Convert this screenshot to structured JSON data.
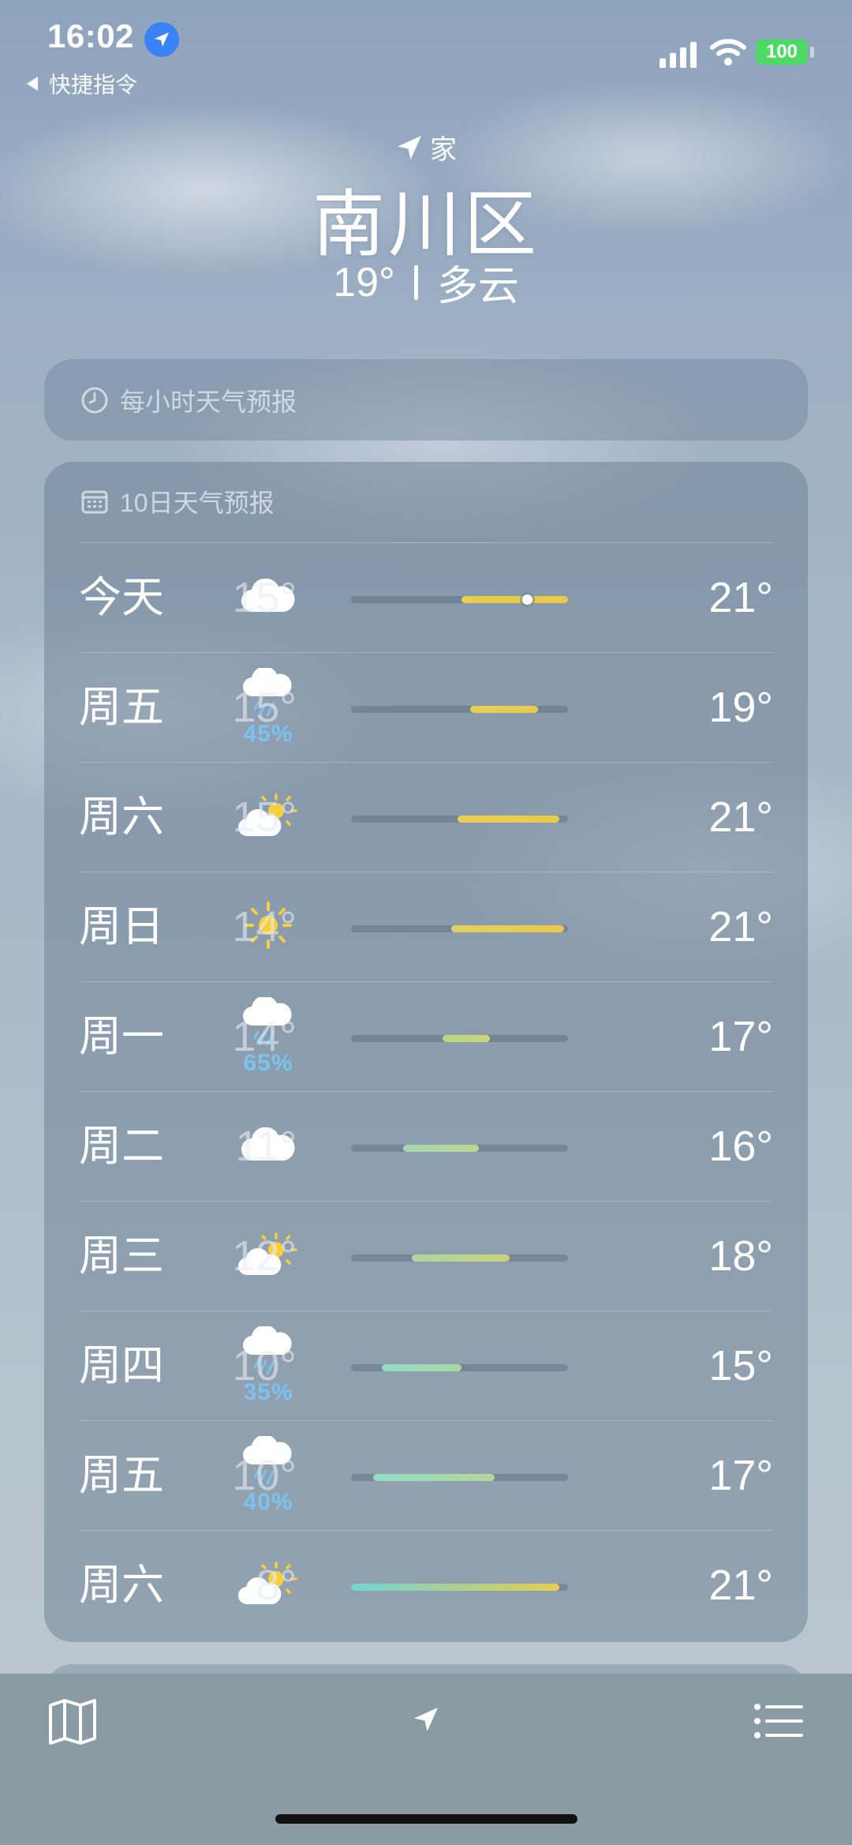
{
  "status_bar": {
    "time": "16:02",
    "back_label": "快捷指令",
    "battery": "100",
    "battery_color": "#4cd964",
    "location_color": "#3a82f7"
  },
  "header": {
    "location_label": "家",
    "city": "南川区",
    "temperature": "19°",
    "condition": "多云"
  },
  "hourly_card": {
    "title": "每小时天气预报",
    "icon": "clock-icon"
  },
  "daily_card": {
    "title": "10日天气预报",
    "icon": "calendar-icon",
    "days": [
      {
        "day": "今天",
        "icon": "cloud-icon",
        "precip": "",
        "low": "15°",
        "high": "21°",
        "bar_start": 0.51,
        "bar_end": 1.0,
        "now": 0.81,
        "gradient": [
          "#e9cd4c",
          "#ecc94a"
        ]
      },
      {
        "day": "周五",
        "icon": "cloud-rain-icon",
        "precip": "45%",
        "low": "15°",
        "high": "19°",
        "bar_start": 0.55,
        "bar_end": 0.86,
        "gradient": [
          "#e7ce52",
          "#e8cb4d"
        ]
      },
      {
        "day": "周六",
        "icon": "partly-sunny-icon",
        "precip": "",
        "low": "15°",
        "high": "21°",
        "bar_start": 0.49,
        "bar_end": 0.96,
        "gradient": [
          "#e8cf55",
          "#ebc94a"
        ]
      },
      {
        "day": "周日",
        "icon": "sun-icon",
        "precip": "",
        "low": "14°",
        "high": "21°",
        "bar_start": 0.46,
        "bar_end": 0.98,
        "gradient": [
          "#dfd065",
          "#ecc94a"
        ]
      },
      {
        "day": "周一",
        "icon": "cloud-rain-icon",
        "precip": "65%",
        "low": "14°",
        "high": "17°",
        "bar_start": 0.42,
        "bar_end": 0.64,
        "gradient": [
          "#b9d684",
          "#cdd377"
        ]
      },
      {
        "day": "周二",
        "icon": "cloud-icon",
        "precip": "",
        "low": "11°",
        "high": "16°",
        "bar_start": 0.24,
        "bar_end": 0.59,
        "gradient": [
          "#a4d8b0",
          "#bfd690"
        ]
      },
      {
        "day": "周三",
        "icon": "partly-sunny-icon",
        "precip": "",
        "low": "12°",
        "high": "18°",
        "bar_start": 0.28,
        "bar_end": 0.73,
        "gradient": [
          "#acd7a2",
          "#c9d27b"
        ]
      },
      {
        "day": "周四",
        "icon": "cloud-rain-icon",
        "precip": "35%",
        "low": "10°",
        "high": "15°",
        "bar_start": 0.14,
        "bar_end": 0.51,
        "gradient": [
          "#8fdcc6",
          "#a9d7a4"
        ]
      },
      {
        "day": "周五",
        "icon": "cloud-rain-icon",
        "precip": "40%",
        "low": "10°",
        "high": "17°",
        "bar_start": 0.1,
        "bar_end": 0.66,
        "gradient": [
          "#8fdcc6",
          "#b4d699"
        ]
      },
      {
        "day": "周六",
        "icon": "partly-sunny-icon",
        "precip": "",
        "low": "8°",
        "high": "21°",
        "bar_start": 0.0,
        "bar_end": 0.96,
        "gradient": [
          "#6fd6d6",
          "#e8cd4e"
        ]
      }
    ]
  },
  "toolbar": {
    "map_icon": "map-icon",
    "location_icon": "location-arrow-icon",
    "list_icon": "list-icon"
  }
}
